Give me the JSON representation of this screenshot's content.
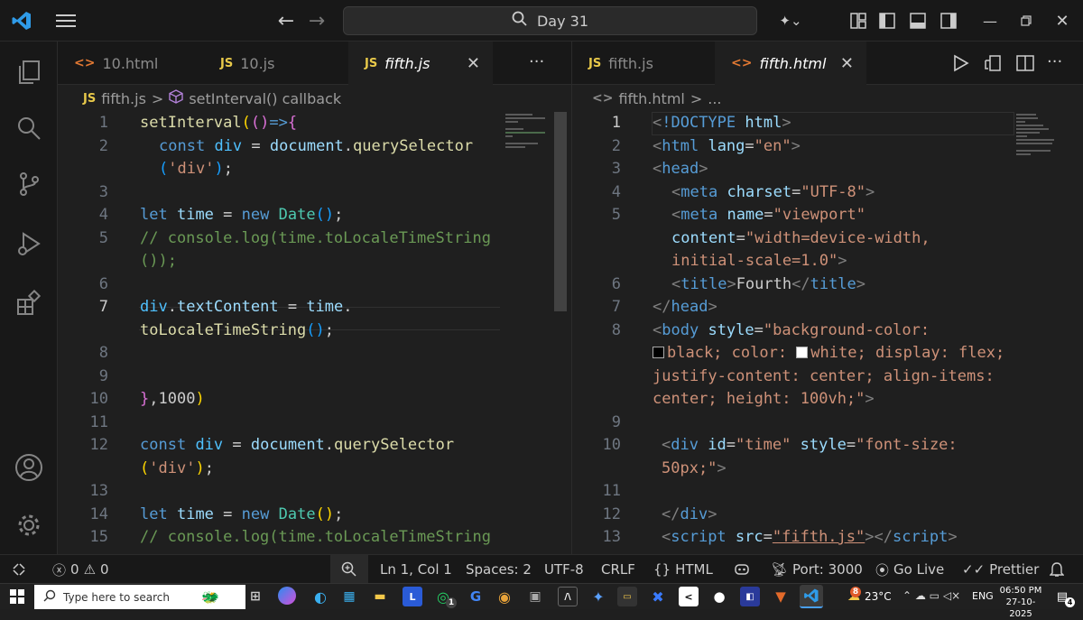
{
  "titlebar": {
    "search": "Day 31"
  },
  "left": {
    "tabs": [
      {
        "label": "10.html",
        "icon": "<>"
      },
      {
        "label": "10.js",
        "icon": "JS"
      },
      {
        "label": "fifth.js",
        "icon": "JS"
      }
    ],
    "more": "···",
    "breadcrumb": {
      "icon": "JS",
      "file": "fifth.js",
      "sep": ">",
      "symbol": "setInterval() callback"
    },
    "line_numbers": [
      "1",
      "2",
      "",
      "3",
      "4",
      "5",
      "",
      "6",
      "7",
      "",
      "8",
      "9",
      "10",
      "11",
      "12",
      "",
      "13",
      "14",
      "15"
    ]
  },
  "right": {
    "tabs": [
      {
        "label": "fifth.js",
        "icon": "JS"
      },
      {
        "label": "fifth.html",
        "icon": "<>"
      }
    ],
    "breadcrumb": {
      "file": "fifth.html",
      "sep": ">",
      "more": "..."
    },
    "line_numbers": [
      "1",
      "2",
      "3",
      "4",
      "5",
      "",
      "",
      "6",
      "7",
      "8",
      "",
      "",
      "",
      "9",
      "10",
      "",
      "11",
      "12",
      "13"
    ]
  },
  "status": {
    "errors": "0",
    "warnings": "0",
    "position": "Ln 1, Col 1",
    "spaces": "Spaces: 2",
    "encoding": "UTF-8",
    "eol": "CRLF",
    "language": "HTML",
    "port": "Port: 3000",
    "golive": "Go Live",
    "prettier": "Prettier"
  },
  "taskbar": {
    "search_placeholder": "Type here to search",
    "temp": "23°C",
    "lang": "ENG",
    "time": "06:50 PM",
    "date": "27-10-2025",
    "notif": "4",
    "whatsapp_badge": "1",
    "weather_badge": "8"
  },
  "colors": {
    "accent": "#0078d4",
    "keyword": "#569cd6",
    "string": "#ce9178",
    "function": "#dcdcaa",
    "comment": "#6a9955"
  }
}
